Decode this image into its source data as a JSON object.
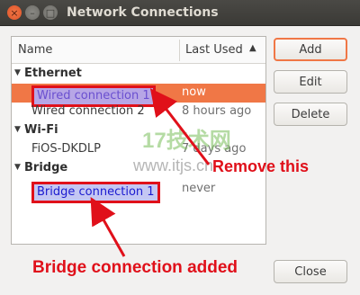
{
  "window": {
    "title": "Network Connections",
    "close_glyph": "×",
    "minimize_glyph": "–",
    "maximize_glyph": "□"
  },
  "list": {
    "columns": [
      "Name",
      "Last Used"
    ],
    "sort_indicator": "▲",
    "expand_glyph": "▼",
    "groups": [
      {
        "name": "Ethernet",
        "items": [
          {
            "name": "Wired connection 1",
            "last_used": "now",
            "selected": true,
            "highlighted": true
          },
          {
            "name": "Wired connection 2",
            "last_used": "8 hours ago"
          }
        ]
      },
      {
        "name": "Wi-Fi",
        "items": [
          {
            "name": "FiOS-DKDLP",
            "last_used": "7 days ago"
          }
        ]
      },
      {
        "name": "Bridge",
        "items": [
          {
            "name": "Bridge connection 1",
            "last_used": "never",
            "highlighted": true
          }
        ]
      }
    ]
  },
  "buttons": {
    "add": "Add",
    "edit": "Edit",
    "delete": "Delete",
    "close": "Close"
  },
  "annotations": {
    "remove_label": "Remove this",
    "added_label": "Bridge connection added",
    "color": "#e0101a"
  },
  "watermark": {
    "line1": "17技术网",
    "line2": "www.itjs.cn"
  }
}
